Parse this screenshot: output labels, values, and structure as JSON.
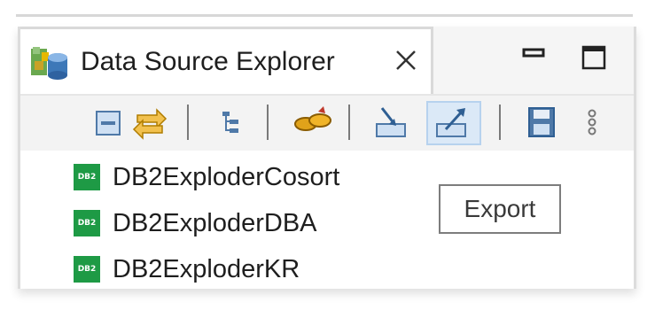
{
  "view": {
    "title": "Data Source Explorer",
    "icon": "database-explorer-icon",
    "close_icon": "close-icon",
    "minimize_icon": "minimize-icon",
    "maximize_icon": "maximize-icon"
  },
  "toolbar": {
    "buttons": [
      {
        "name": "collapse-all-icon"
      },
      {
        "name": "link-with-editor-icon"
      },
      {
        "name": "tree-view-icon"
      },
      {
        "name": "connect-icon"
      },
      {
        "name": "import-icon"
      },
      {
        "name": "export-icon",
        "active": true
      },
      {
        "name": "save-icon"
      },
      {
        "name": "view-menu-icon"
      }
    ]
  },
  "tree": {
    "items": [
      {
        "icon_text": "DB2",
        "label": "DB2ExploderCosort"
      },
      {
        "icon_text": "DB2",
        "label": "DB2ExploderDBA"
      },
      {
        "icon_text": "DB2",
        "label": "DB2ExploderKR"
      }
    ]
  },
  "tooltip": {
    "text": "Export"
  },
  "colors": {
    "db_icon": "#1e9a45",
    "active_button_bg": "#dbe9f7"
  }
}
